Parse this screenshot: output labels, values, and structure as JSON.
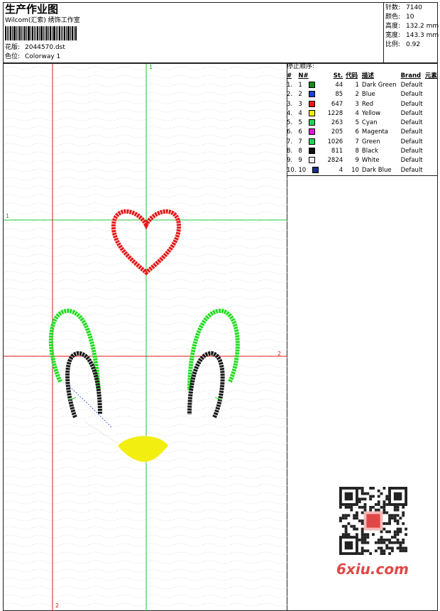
{
  "header": {
    "title": "生产作业图",
    "company": "Wilcom(汇索) 绣饰工作室",
    "design_label": "花版:",
    "design_value": "2044570.dst",
    "colorway_label": "色位:",
    "colorway_value": "Colorway 1"
  },
  "stats": {
    "stitches_label": "针数:",
    "stitches_value": "7140",
    "colors_label": "颜色:",
    "colors_value": "10",
    "height_label": "高度:",
    "height_value": "132.2 mm",
    "width_label": "宽度:",
    "width_value": "143.3 mm",
    "scale_label": "比例:",
    "scale_value": "0.92"
  },
  "stop_sequence": {
    "title": "停止顺序:",
    "headers": [
      "#",
      "N#",
      "St.",
      "代码",
      "描述",
      "Brand",
      "元素"
    ],
    "rows": [
      {
        "num": "1.",
        "n": "1",
        "st": "44",
        "code": "1",
        "desc": "Dark Green",
        "brand": "Default",
        "color": "#1a8a1a"
      },
      {
        "num": "2.",
        "n": "2",
        "st": "85",
        "code": "2",
        "desc": "Blue",
        "brand": "Default",
        "color": "#1f3fd0"
      },
      {
        "num": "3.",
        "n": "3",
        "st": "647",
        "code": "3",
        "desc": "Red",
        "brand": "Default",
        "color": "#e81818"
      },
      {
        "num": "4.",
        "n": "4",
        "st": "1228",
        "code": "4",
        "desc": "Yellow",
        "brand": "Default",
        "color": "#f2ee10"
      },
      {
        "num": "5.",
        "n": "5",
        "st": "263",
        "code": "5",
        "desc": "Cyan",
        "brand": "Default",
        "color": "#22d35a"
      },
      {
        "num": "6.",
        "n": "6",
        "st": "205",
        "code": "6",
        "desc": "Magenta",
        "brand": "Default",
        "color": "#e01ad6"
      },
      {
        "num": "7.",
        "n": "7",
        "st": "1026",
        "code": "7",
        "desc": "Green",
        "brand": "Default",
        "color": "#22d35a"
      },
      {
        "num": "8.",
        "n": "8",
        "st": "811",
        "code": "8",
        "desc": "Black",
        "brand": "Default",
        "color": "#111111"
      },
      {
        "num": "9.",
        "n": "9",
        "st": "2824",
        "code": "9",
        "desc": "White",
        "brand": "Default",
        "color": "#f4f4f4"
      },
      {
        "num": "10.",
        "n": "10",
        "st": "4",
        "code": "10",
        "desc": "Dark Blue",
        "brand": "Default",
        "color": "#1a2a9a"
      }
    ]
  },
  "guides": {
    "top_label": "1",
    "left_label": "1",
    "right_label": "2",
    "bottom_label": "2"
  },
  "watermark": "6xiu.com",
  "colors": {
    "guide_green": "#22c83a",
    "guide_red": "#e01818",
    "heart": "#e81818",
    "ear_outer": "#22dd22",
    "ear_inner": "#181818",
    "nose": "#f2ee10",
    "travel": "#2a3ad0"
  }
}
